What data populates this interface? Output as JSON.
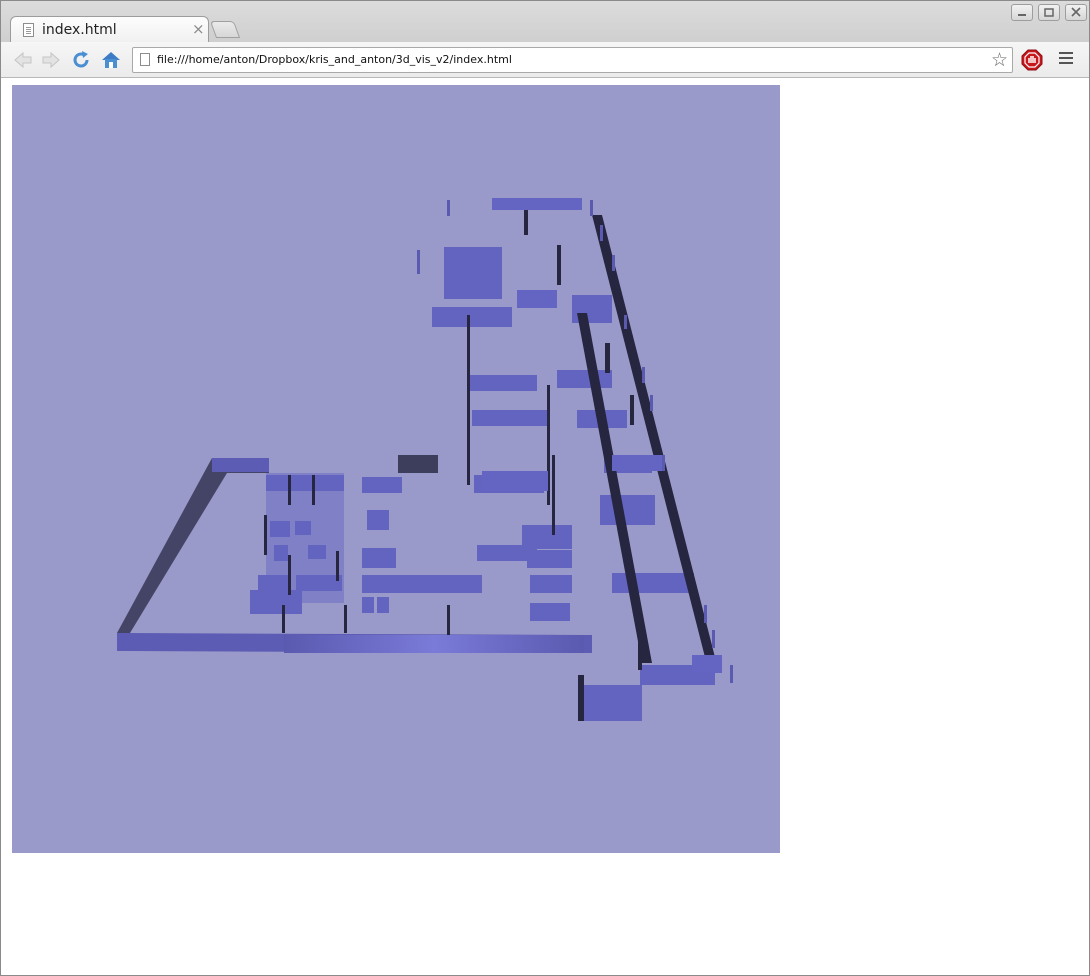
{
  "window": {
    "controls": {
      "minimize_icon": "minimize-icon",
      "maximize_icon": "maximize-icon",
      "close_icon": "close-icon"
    }
  },
  "tabs": [
    {
      "title": "index.html",
      "close_label": "×",
      "icon": "page-icon"
    }
  ],
  "toolbar": {
    "back_icon": "back-arrow-icon",
    "forward_icon": "forward-arrow-icon",
    "reload_icon": "reload-icon",
    "home_icon": "home-icon",
    "url": "file:///home/anton/Dropbox/kris_and_anton/3d_vis_v2/index.html",
    "bookmark_icon": "star-icon",
    "extension_icon": "adblock-icon",
    "menu_icon": "hamburger-menu-icon"
  },
  "colors": {
    "canvas_background": "#9a9aca",
    "wall_top": "#6767c2",
    "wall_face": "#5757ad",
    "wall_shadow": "#2a2a40"
  },
  "viewport": {
    "content": "3D floor plan visualization (WebGL canvas)"
  }
}
